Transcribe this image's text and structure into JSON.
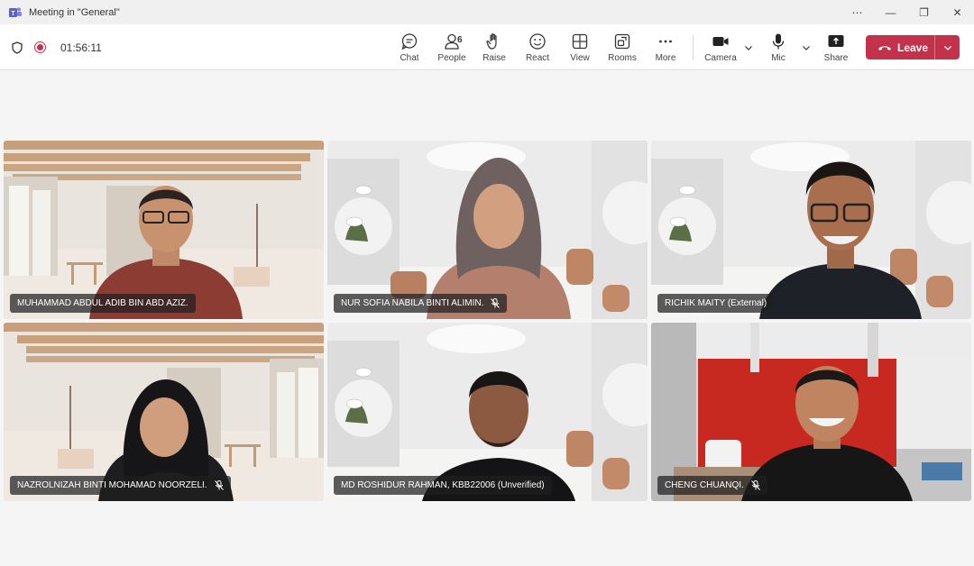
{
  "window": {
    "title": "Meeting in \"General\""
  },
  "window_controls": {
    "more": "⋯",
    "minimize": "—",
    "restore": "❐",
    "close": "✕"
  },
  "toolbar": {
    "timer": "01:56:11",
    "buttons": {
      "chat": "Chat",
      "people": "People",
      "people_count": "6",
      "raise": "Raise",
      "react": "React",
      "view": "View",
      "rooms": "Rooms",
      "more": "More",
      "camera": "Camera",
      "mic": "Mic",
      "share": "Share"
    },
    "leave": "Leave"
  },
  "colors": {
    "leave_red": "#c4314b",
    "accent": "#5b5fc7"
  },
  "participants": [
    {
      "name": "MUHAMMAD ABDUL ADIB BIN ABD AZIZ.",
      "muted": false
    },
    {
      "name": "NUR SOFIA NABILA BINTI ALIMIN.",
      "muted": true
    },
    {
      "name": "RICHIK MAITY (External)",
      "muted": false
    },
    {
      "name": "NAZROLNIZAH BINTI MOHAMAD NOORZELI.",
      "muted": true
    },
    {
      "name": "MD ROSHIDUR RAHMAN, KBB22006 (Unverified)",
      "muted": false
    },
    {
      "name": "CHENG CHUANQI.",
      "muted": true
    }
  ]
}
